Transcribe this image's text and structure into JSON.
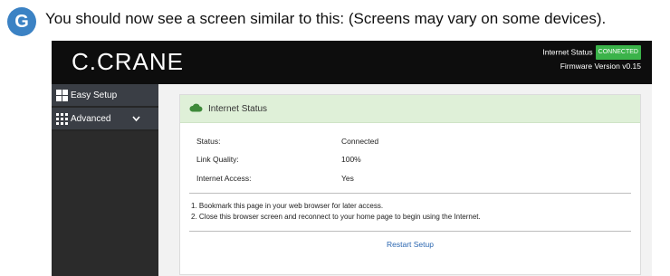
{
  "step": {
    "letter": "G",
    "text": "You should now see a screen similar to this: (Screens may vary on some devices)."
  },
  "header": {
    "logo": "C.CRANE",
    "internet_status_label": "Internet Status",
    "status_badge": "CONNECTED",
    "firmware": "Firmware Version v0.15"
  },
  "sidebar": {
    "items": [
      {
        "label": "Easy Setup",
        "icon": "puzzle-icon"
      },
      {
        "label": "Advanced",
        "icon": "grid-icon"
      }
    ]
  },
  "panel": {
    "title": "Internet Status",
    "icon": "cloud-icon",
    "rows": [
      {
        "label": "Status:",
        "value": "Connected"
      },
      {
        "label": "Link Quality:",
        "value": "100%"
      },
      {
        "label": "Internet Access:",
        "value": "Yes"
      }
    ],
    "notes": [
      "1. Bookmark this page in your web browser for later access.",
      "2. Close this browser screen and reconnect to your home page to begin using the Internet."
    ],
    "restart_label": "Restart Setup"
  },
  "colors": {
    "step_circle": "#3b82c4",
    "header_bg": "#0d0d0d",
    "badge": "#3bb34a",
    "panel_header": "#dff0d8",
    "link": "#2a66b0"
  }
}
